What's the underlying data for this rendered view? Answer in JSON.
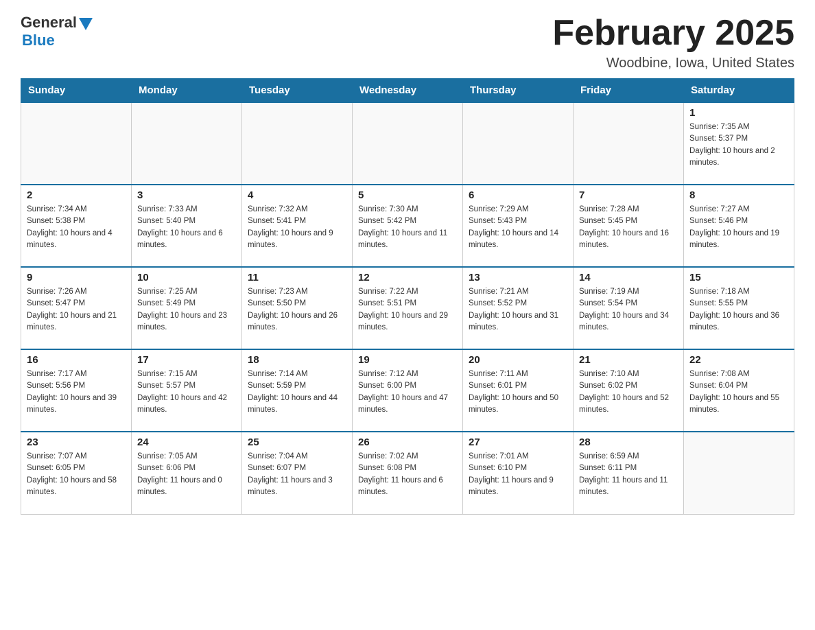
{
  "header": {
    "logo_general": "General",
    "logo_blue": "Blue",
    "title": "February 2025",
    "location": "Woodbine, Iowa, United States"
  },
  "days_of_week": [
    "Sunday",
    "Monday",
    "Tuesday",
    "Wednesday",
    "Thursday",
    "Friday",
    "Saturday"
  ],
  "weeks": [
    [
      {
        "day": "",
        "info": ""
      },
      {
        "day": "",
        "info": ""
      },
      {
        "day": "",
        "info": ""
      },
      {
        "day": "",
        "info": ""
      },
      {
        "day": "",
        "info": ""
      },
      {
        "day": "",
        "info": ""
      },
      {
        "day": "1",
        "info": "Sunrise: 7:35 AM\nSunset: 5:37 PM\nDaylight: 10 hours and 2 minutes."
      }
    ],
    [
      {
        "day": "2",
        "info": "Sunrise: 7:34 AM\nSunset: 5:38 PM\nDaylight: 10 hours and 4 minutes."
      },
      {
        "day": "3",
        "info": "Sunrise: 7:33 AM\nSunset: 5:40 PM\nDaylight: 10 hours and 6 minutes."
      },
      {
        "day": "4",
        "info": "Sunrise: 7:32 AM\nSunset: 5:41 PM\nDaylight: 10 hours and 9 minutes."
      },
      {
        "day": "5",
        "info": "Sunrise: 7:30 AM\nSunset: 5:42 PM\nDaylight: 10 hours and 11 minutes."
      },
      {
        "day": "6",
        "info": "Sunrise: 7:29 AM\nSunset: 5:43 PM\nDaylight: 10 hours and 14 minutes."
      },
      {
        "day": "7",
        "info": "Sunrise: 7:28 AM\nSunset: 5:45 PM\nDaylight: 10 hours and 16 minutes."
      },
      {
        "day": "8",
        "info": "Sunrise: 7:27 AM\nSunset: 5:46 PM\nDaylight: 10 hours and 19 minutes."
      }
    ],
    [
      {
        "day": "9",
        "info": "Sunrise: 7:26 AM\nSunset: 5:47 PM\nDaylight: 10 hours and 21 minutes."
      },
      {
        "day": "10",
        "info": "Sunrise: 7:25 AM\nSunset: 5:49 PM\nDaylight: 10 hours and 23 minutes."
      },
      {
        "day": "11",
        "info": "Sunrise: 7:23 AM\nSunset: 5:50 PM\nDaylight: 10 hours and 26 minutes."
      },
      {
        "day": "12",
        "info": "Sunrise: 7:22 AM\nSunset: 5:51 PM\nDaylight: 10 hours and 29 minutes."
      },
      {
        "day": "13",
        "info": "Sunrise: 7:21 AM\nSunset: 5:52 PM\nDaylight: 10 hours and 31 minutes."
      },
      {
        "day": "14",
        "info": "Sunrise: 7:19 AM\nSunset: 5:54 PM\nDaylight: 10 hours and 34 minutes."
      },
      {
        "day": "15",
        "info": "Sunrise: 7:18 AM\nSunset: 5:55 PM\nDaylight: 10 hours and 36 minutes."
      }
    ],
    [
      {
        "day": "16",
        "info": "Sunrise: 7:17 AM\nSunset: 5:56 PM\nDaylight: 10 hours and 39 minutes."
      },
      {
        "day": "17",
        "info": "Sunrise: 7:15 AM\nSunset: 5:57 PM\nDaylight: 10 hours and 42 minutes."
      },
      {
        "day": "18",
        "info": "Sunrise: 7:14 AM\nSunset: 5:59 PM\nDaylight: 10 hours and 44 minutes."
      },
      {
        "day": "19",
        "info": "Sunrise: 7:12 AM\nSunset: 6:00 PM\nDaylight: 10 hours and 47 minutes."
      },
      {
        "day": "20",
        "info": "Sunrise: 7:11 AM\nSunset: 6:01 PM\nDaylight: 10 hours and 50 minutes."
      },
      {
        "day": "21",
        "info": "Sunrise: 7:10 AM\nSunset: 6:02 PM\nDaylight: 10 hours and 52 minutes."
      },
      {
        "day": "22",
        "info": "Sunrise: 7:08 AM\nSunset: 6:04 PM\nDaylight: 10 hours and 55 minutes."
      }
    ],
    [
      {
        "day": "23",
        "info": "Sunrise: 7:07 AM\nSunset: 6:05 PM\nDaylight: 10 hours and 58 minutes."
      },
      {
        "day": "24",
        "info": "Sunrise: 7:05 AM\nSunset: 6:06 PM\nDaylight: 11 hours and 0 minutes."
      },
      {
        "day": "25",
        "info": "Sunrise: 7:04 AM\nSunset: 6:07 PM\nDaylight: 11 hours and 3 minutes."
      },
      {
        "day": "26",
        "info": "Sunrise: 7:02 AM\nSunset: 6:08 PM\nDaylight: 11 hours and 6 minutes."
      },
      {
        "day": "27",
        "info": "Sunrise: 7:01 AM\nSunset: 6:10 PM\nDaylight: 11 hours and 9 minutes."
      },
      {
        "day": "28",
        "info": "Sunrise: 6:59 AM\nSunset: 6:11 PM\nDaylight: 11 hours and 11 minutes."
      },
      {
        "day": "",
        "info": ""
      }
    ]
  ]
}
